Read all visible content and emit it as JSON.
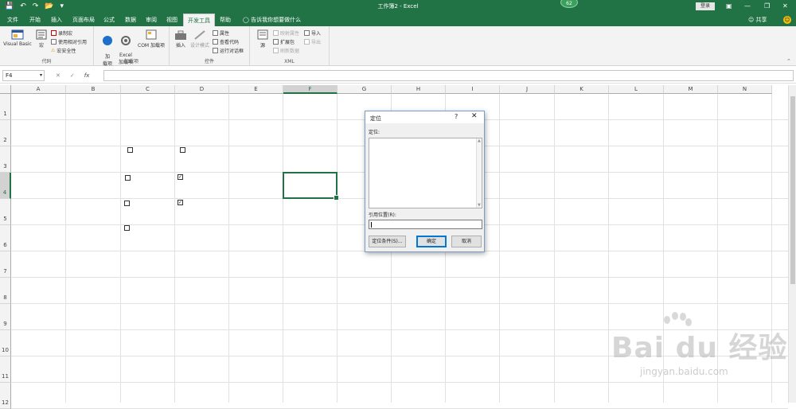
{
  "title_bar": {
    "title": "工作簿2  -  Excel",
    "avatar_text": "62",
    "login_label": "登录"
  },
  "menu": {
    "tabs": [
      "文件",
      "开始",
      "插入",
      "页面布局",
      "公式",
      "数据",
      "审阅",
      "视图",
      "开发工具",
      "帮助"
    ],
    "active_tab": "开发工具",
    "tell_me": "告诉我你想要做什么",
    "share_label": "共享"
  },
  "ribbon": {
    "code": {
      "label": "代码",
      "visual_basic": "Visual Basic",
      "macro": "宏",
      "record_macro": "录制宏",
      "relative_ref": "使用相对引用",
      "macro_security": "宏安全性"
    },
    "addins": {
      "label": "加载项",
      "addins": "加\n载项",
      "excel_addins": "Excel\n加载项",
      "com_addins": "COM 加载项"
    },
    "controls": {
      "label": "控件",
      "insert": "插入",
      "design_mode": "设计模式",
      "properties": "属性",
      "view_code": "查看代码",
      "run_dialog": "运行对话框"
    },
    "xml": {
      "label": "XML",
      "source": "源",
      "map_properties": "映射属性",
      "expansion_pack": "扩展包",
      "refresh_data": "刷新数据",
      "import": "导入",
      "export": "导出"
    }
  },
  "formula_bar": {
    "name_box": "F4",
    "fx": "fx",
    "formula": ""
  },
  "sheet": {
    "columns": [
      "A",
      "B",
      "C",
      "D",
      "E",
      "F",
      "G",
      "H",
      "I",
      "J",
      "K",
      "L",
      "M",
      "N"
    ],
    "rows": [
      "1",
      "2",
      "3",
      "4",
      "5",
      "6",
      "7",
      "8",
      "9",
      "10",
      "11",
      "12"
    ],
    "selected_cell": "F4",
    "checkboxes": [
      {
        "cell": "C3",
        "checked": false
      },
      {
        "cell": "D3",
        "checked": false
      },
      {
        "cell": "C4",
        "checked": false
      },
      {
        "cell": "D4",
        "checked": true
      },
      {
        "cell": "C5",
        "checked": false
      },
      {
        "cell": "D5",
        "checked": true
      },
      {
        "cell": "C6",
        "checked": false
      }
    ]
  },
  "dialog": {
    "title": "定位",
    "help": "?",
    "close": "✕",
    "goto_label": "定位:",
    "reference_label": "引用位置(R):",
    "reference_value": "",
    "special_button": "定位条件(S)...",
    "ok_button": "确定",
    "cancel_button": "取消"
  },
  "watermark": {
    "brand": "Bai du 经验",
    "url": "jingyan.baidu.com"
  },
  "colors": {
    "excel_green": "#217346",
    "selection_green": "#217346",
    "dialog_primary": "#0078d7"
  }
}
